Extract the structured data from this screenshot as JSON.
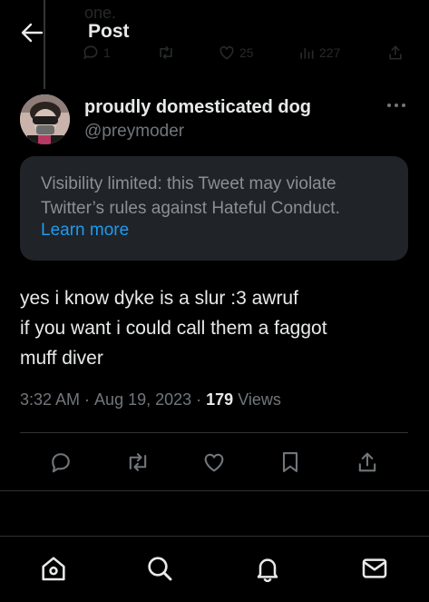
{
  "previous_tweet": {
    "text_fragment": "one.",
    "reply_count": "1",
    "like_count": "25",
    "view_count": "227"
  },
  "header": {
    "back_icon": "arrow-left-icon",
    "title": "Post"
  },
  "tweet": {
    "author_name": "proudly domesticated dog",
    "author_handle": "@preymoder",
    "more_icon": "more-horizontal-icon",
    "notice": {
      "text": "Visibility limited: this Tweet may violate Twitter’s rules against Hateful Conduct.",
      "link_label": "Learn more"
    },
    "body_lines": [
      "yes i know dyke is a slur :3 awruf",
      "if you want i could call them a faggot",
      "muff diver"
    ],
    "time": "3:32 AM",
    "date": "Aug 19, 2023",
    "separator": "·",
    "views_count": "179",
    "views_label": "Views",
    "actions": [
      "reply-icon",
      "retweet-icon",
      "like-icon",
      "bookmark-icon",
      "share-icon"
    ]
  },
  "bottom_nav": {
    "items": [
      "home-icon",
      "search-icon",
      "notifications-icon",
      "messages-icon"
    ]
  },
  "colors": {
    "background": "#000000",
    "text_primary": "#e7e9ea",
    "text_secondary": "#71767b",
    "link": "#1d9bf0",
    "notice_bg": "#202327",
    "divider": "#2f3336"
  }
}
